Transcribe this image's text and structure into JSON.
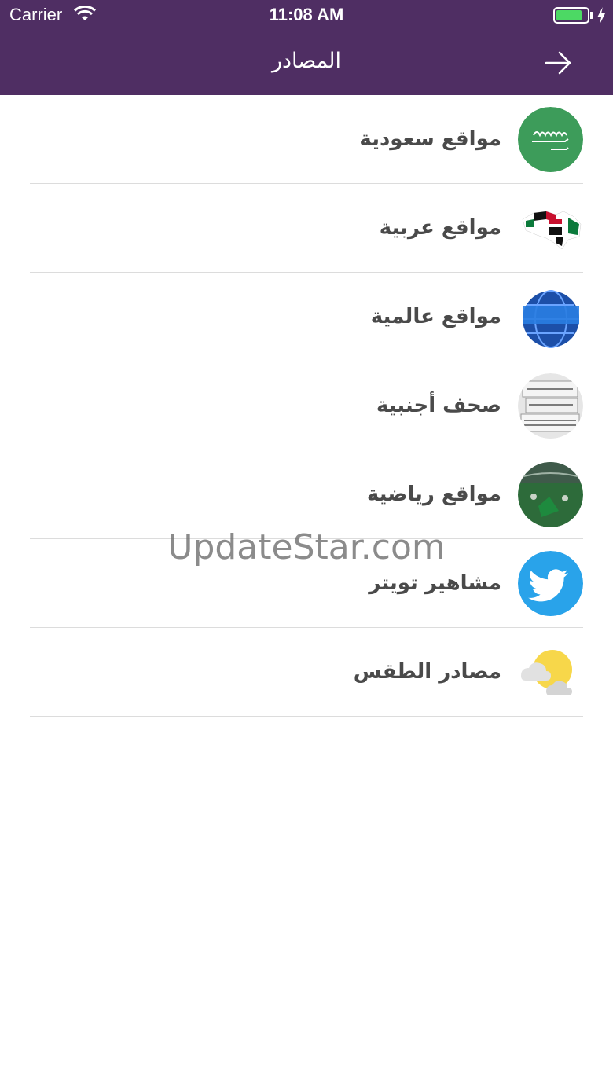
{
  "status_bar": {
    "carrier": "Carrier",
    "time": "11:08 AM",
    "battery_level": 0.85
  },
  "nav": {
    "title": "المصادر"
  },
  "colors": {
    "header": "#4f2e63",
    "battery": "#4cd964",
    "twitter": "#29a3ea"
  },
  "sources": [
    {
      "label": "مواقع سعودية",
      "icon": "saudi-flag-icon"
    },
    {
      "label": "مواقع عربية",
      "icon": "arab-world-map-icon"
    },
    {
      "label": "مواقع عالمية",
      "icon": "global-news-globe-icon"
    },
    {
      "label": "صحف أجنبية",
      "icon": "newspapers-icon"
    },
    {
      "label": "مواقع رياضية",
      "icon": "stadium-crowd-icon"
    },
    {
      "label": "مشاهير تويتر",
      "icon": "twitter-bird-icon"
    },
    {
      "label": "مصادر الطقس",
      "icon": "weather-sun-cloud-icon"
    }
  ],
  "watermark": "UpdateStar.com"
}
